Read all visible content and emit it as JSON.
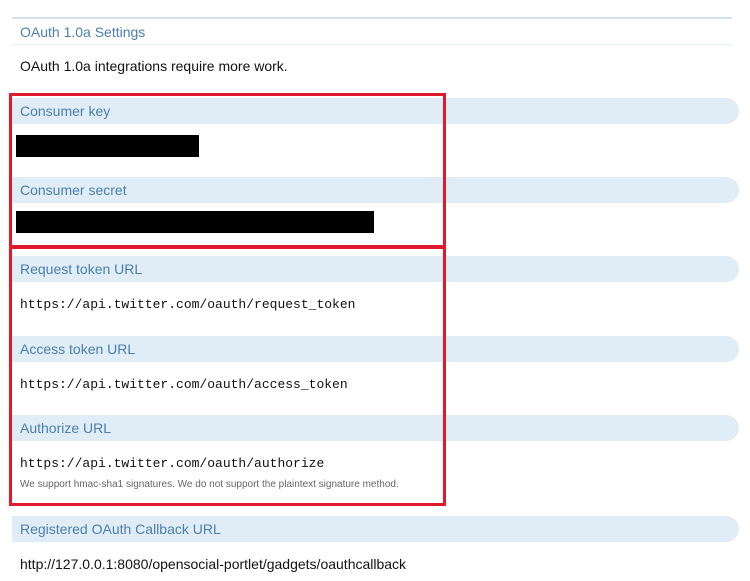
{
  "section": {
    "title": "OAuth 1.0a Settings",
    "intro": "OAuth 1.0a integrations require more work."
  },
  "fields": {
    "consumer_key": {
      "label": "Consumer key",
      "value_redacted": true
    },
    "consumer_secret": {
      "label": "Consumer secret",
      "value_redacted": true
    },
    "request_token_url": {
      "label": "Request token URL",
      "value": "https://api.twitter.com/oauth/request_token"
    },
    "access_token_url": {
      "label": "Access token URL",
      "value": "https://api.twitter.com/oauth/access_token"
    },
    "authorize_url": {
      "label": "Authorize URL",
      "value": "https://api.twitter.com/oauth/authorize",
      "note": "We support hmac-sha1 signatures. We do not support the plaintext signature method."
    },
    "callback_url": {
      "label": "Registered OAuth Callback URL",
      "value": "http://127.0.0.1:8080/opensocial-portlet/gadgets/oauthcallback"
    }
  },
  "colors": {
    "label_text": "#4a7fae",
    "label_background": "#e0edf7",
    "highlight_border": "#e0192c",
    "redaction": "#000000"
  }
}
